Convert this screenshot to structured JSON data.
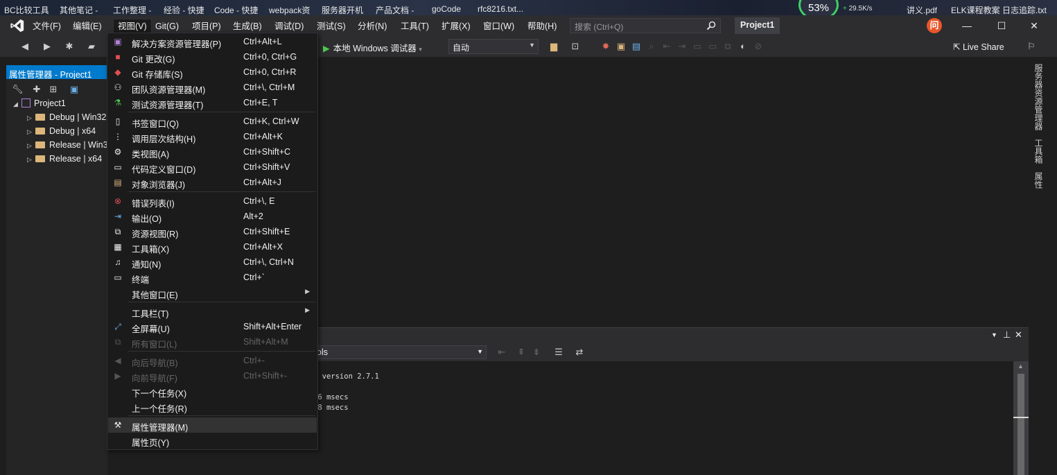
{
  "desktop": {
    "items": [
      "BC比较工具",
      "其他笔记 -",
      "工作整理 -",
      "经验 - 快捷",
      "Code - 快捷",
      "webpack资",
      "服务器开机",
      "产品文档 -",
      "goCode",
      "rfc8216.txt...",
      "讲义.pdf",
      "ELK课程教案 日志追踪.txt"
    ],
    "gauge": "53%",
    "speed": "29.5K/s"
  },
  "menubar": {
    "items": [
      "文件(F)",
      "编辑(E)",
      "视图(V)",
      "Git(G)",
      "项目(P)",
      "生成(B)",
      "调试(D)",
      "测试(S)",
      "分析(N)",
      "工具(T)",
      "扩展(X)",
      "窗口(W)",
      "帮助(H)"
    ],
    "search_placeholder": "搜索 (Ctrl+Q)",
    "project": "Project1",
    "user_initial": "问"
  },
  "toolbar": {
    "run_label": "本地 Windows 调试器",
    "config": "自动",
    "live_share": "Live Share"
  },
  "prop_panel": {
    "title": "属性管理器 - Project1",
    "root": "Project1",
    "children": [
      "Debug | Win32",
      "Debug | x64",
      "Release | Win32",
      "Release | x64"
    ]
  },
  "right_tabs": [
    "服务器资源管理器",
    "工具箱",
    "属性"
  ],
  "output": {
    "source": "ols",
    "lines": [
      "s version 2.7.1",
      "",
      "06 msecs",
      "58 msecs"
    ]
  },
  "view_menu": {
    "items": [
      {
        "label": "解决方案资源管理器(P)",
        "key": "Ctrl+Alt+L",
        "icon": "solution-explorer-icon"
      },
      {
        "label": "Git 更改(G)",
        "key": "Ctrl+0, Ctrl+G",
        "icon": "git-changes-icon"
      },
      {
        "label": "Git 存储库(S)",
        "key": "Ctrl+0, Ctrl+R",
        "icon": "git-repo-icon"
      },
      {
        "label": "团队资源管理器(M)",
        "key": "Ctrl+\\, Ctrl+M",
        "icon": "team-explorer-icon"
      },
      {
        "label": "测试资源管理器(T)",
        "key": "Ctrl+E, T",
        "icon": "test-explorer-icon"
      },
      {
        "label": "书签窗口(Q)",
        "key": "Ctrl+K, Ctrl+W",
        "icon": "bookmark-icon"
      },
      {
        "label": "调用层次结构(H)",
        "key": "Ctrl+Alt+K",
        "icon": "call-hierarchy-icon"
      },
      {
        "label": "类视图(A)",
        "key": "Ctrl+Shift+C",
        "icon": "class-view-icon"
      },
      {
        "label": "代码定义窗口(D)",
        "key": "Ctrl+Shift+V",
        "icon": "code-definition-icon"
      },
      {
        "label": "对象浏览器(J)",
        "key": "Ctrl+Alt+J",
        "icon": "object-browser-icon"
      },
      {
        "label": "错误列表(I)",
        "key": "Ctrl+\\, E",
        "icon": "error-list-icon"
      },
      {
        "label": "输出(O)",
        "key": "Alt+2",
        "icon": "output-icon"
      },
      {
        "label": "资源视图(R)",
        "key": "Ctrl+Shift+E",
        "icon": "resource-view-icon"
      },
      {
        "label": "工具箱(X)",
        "key": "Ctrl+Alt+X",
        "icon": "toolbox-icon"
      },
      {
        "label": "通知(N)",
        "key": "Ctrl+\\, Ctrl+N",
        "icon": "bell-icon"
      },
      {
        "label": "终端",
        "key": "Ctrl+`",
        "icon": "terminal-icon"
      },
      {
        "label": "其他窗口(E)",
        "key": "",
        "icon": ""
      },
      {
        "label": "工具栏(T)",
        "key": "",
        "icon": ""
      },
      {
        "label": "全屏幕(U)",
        "key": "Shift+Alt+Enter",
        "icon": "fullscreen-icon"
      },
      {
        "label": "所有窗口(L)",
        "key": "Shift+Alt+M",
        "icon": "all-windows-icon"
      },
      {
        "label": "向后导航(B)",
        "key": "Ctrl+-",
        "icon": "back-icon"
      },
      {
        "label": "向前导航(F)",
        "key": "Ctrl+Shift+-",
        "icon": "forward-icon"
      },
      {
        "label": "下一个任务(X)",
        "key": "",
        "icon": ""
      },
      {
        "label": "上一个任务(R)",
        "key": "",
        "icon": ""
      },
      {
        "label": "属性管理器(M)",
        "key": "",
        "icon": "wrench-icon"
      },
      {
        "label": "属性页(Y)",
        "key": "",
        "icon": ""
      }
    ]
  },
  "colors": {
    "accent": "#007acc",
    "bg": "#1e1e1e",
    "chrome": "#2d2d30",
    "menu": "#1b1b1c"
  }
}
